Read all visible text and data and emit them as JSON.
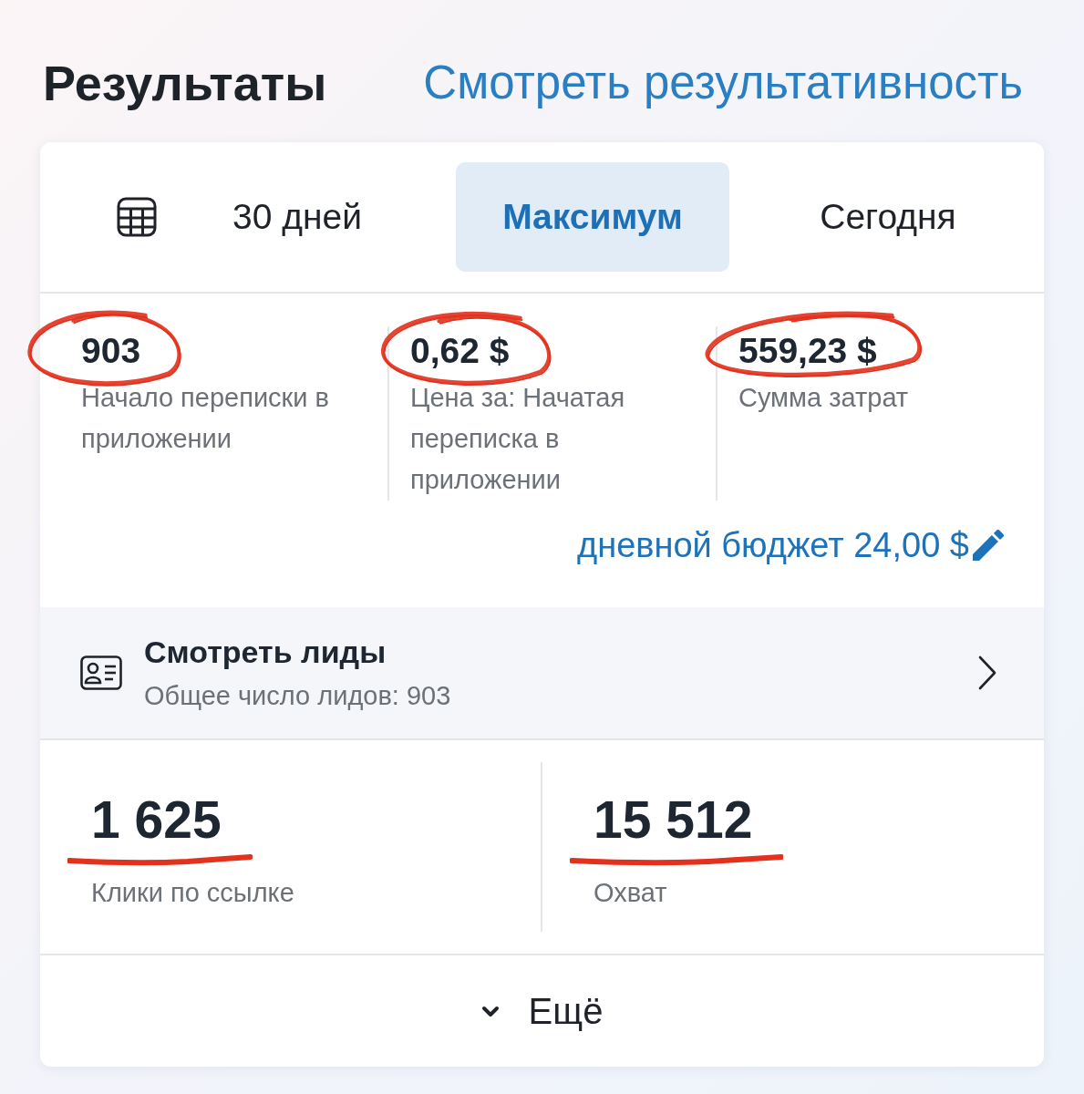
{
  "header": {
    "title": "Результаты",
    "link": "Смотреть результативность"
  },
  "period_tabs": [
    {
      "label": "30 дней",
      "selected": false
    },
    {
      "label": "Максимум",
      "selected": true
    },
    {
      "label": "Сегодня",
      "selected": false
    }
  ],
  "metrics": [
    {
      "value": "903",
      "label": "Начало переписки в приложении",
      "circled": true
    },
    {
      "value": "0,62 $",
      "label": "Цена за: Начатая переписка в приложении",
      "circled": true
    },
    {
      "value": "559,23 $",
      "label": "Сумма затрат",
      "circled": true
    }
  ],
  "daily_budget": "дневной бюджет 24,00 $",
  "leads": {
    "title": "Смотреть лиды",
    "subtitle": "Общее число лидов: 903"
  },
  "stats": [
    {
      "value": "1 625",
      "label": "Клики по ссылке",
      "underlined": true
    },
    {
      "value": "15 512",
      "label": "Охват",
      "underlined": true
    }
  ],
  "more_button": "Ещё"
}
